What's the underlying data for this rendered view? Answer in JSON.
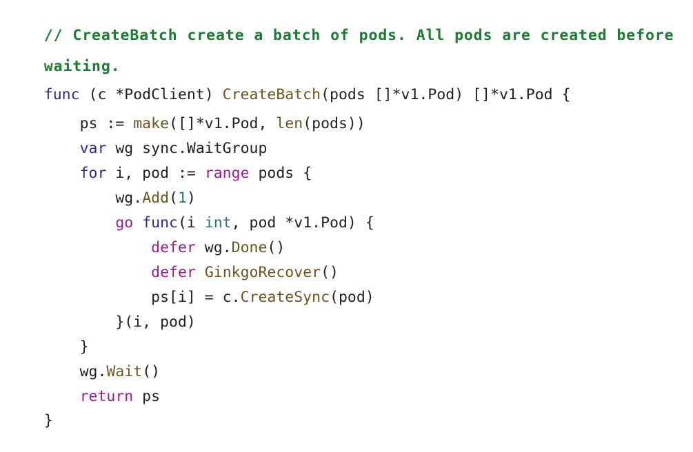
{
  "code_view": {
    "lines": {
      "comment1": "// CreateBatch create a batch of pods. All pods are created before",
      "comment2": "waiting.",
      "func_line": {
        "kw_func": "func",
        "recv": " (c *PodClient) ",
        "fname": "CreateBatch",
        "params": "(pods []*v1.Pod) []*v1.Pod {"
      },
      "ps_make": {
        "indent": "    ",
        "lhs": "ps := ",
        "fn_make": "make",
        "mid": "([]*v1.Pod, ",
        "fn_len": "len",
        "tail": "(pods))"
      },
      "var_wg": {
        "indent": "    ",
        "kw_var": "var",
        "rest": " wg sync.WaitGroup"
      },
      "for_range": {
        "indent": "    ",
        "kw_for": "for",
        "mid": " i, pod := ",
        "kw_range": "range",
        "tail": " pods {"
      },
      "wg_add": {
        "indent": "        ",
        "obj": "wg.",
        "fn": "Add",
        "open": "(",
        "num": "1",
        "close": ")"
      },
      "go_func": {
        "indent": "        ",
        "kw_go": "go",
        "space": " ",
        "kw_func": "func",
        "open": "(i ",
        "type_int": "int",
        "tail": ", pod *v1.Pod) {"
      },
      "defer_done": {
        "indent": "            ",
        "kw_defer": "defer",
        "obj": " wg.",
        "fn": "Done",
        "tail": "()"
      },
      "defer_recover": {
        "indent": "            ",
        "kw_defer": "defer",
        "space": " ",
        "fn": "GinkgoRecover",
        "tail": "()"
      },
      "ps_assign": {
        "indent": "            ",
        "lhs": "ps[i] = c.",
        "fn": "CreateSync",
        "tail": "(pod)"
      },
      "close_call": {
        "indent": "        ",
        "text": "}(i, pod)"
      },
      "close_for": {
        "indent": "    ",
        "text": "}"
      },
      "wg_wait": {
        "indent": "    ",
        "obj": "wg.",
        "fn": "Wait",
        "tail": "()"
      },
      "return_ps": {
        "indent": "    ",
        "kw_return": "return",
        "tail": " ps"
      },
      "close_func": "}"
    },
    "colors": {
      "comment": "#1d7a33",
      "keyword": "#2f2a8a",
      "control_keyword": "#9b1c8f",
      "function_name": "#6b5522",
      "type": "#2f6f7a",
      "plain": "#1f1f1f",
      "background": "#ffffff"
    }
  }
}
